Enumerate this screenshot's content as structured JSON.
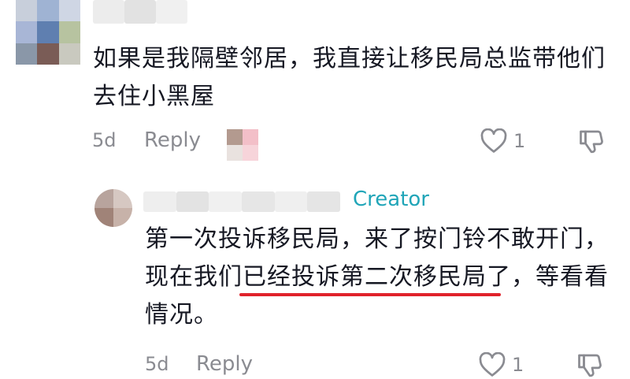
{
  "comment1": {
    "text_line1": "如果是我隔壁邻居，我直接让移民局总监带他们",
    "text_line2": "去住小黑屋",
    "age": "5d",
    "reply_label": "Reply",
    "like_count": "1"
  },
  "reply1": {
    "badge": "Creator",
    "text_line1": "第一次投诉移民局，来了按门铃不敢开门，",
    "text_line2_pre": "现在我们",
    "text_line2_underlined": "已经投诉第二次移民局了",
    "text_line2_post": "，等看看",
    "text_line3": "情况。",
    "age": "5d",
    "reply_label": "Reply",
    "like_count": "1"
  },
  "colors": {
    "creator_badge": "#20a5b8",
    "underline": "#e0222b",
    "muted": "#8a8b91"
  },
  "icons": [
    "heart-outline-icon",
    "thumbs-down-icon"
  ]
}
